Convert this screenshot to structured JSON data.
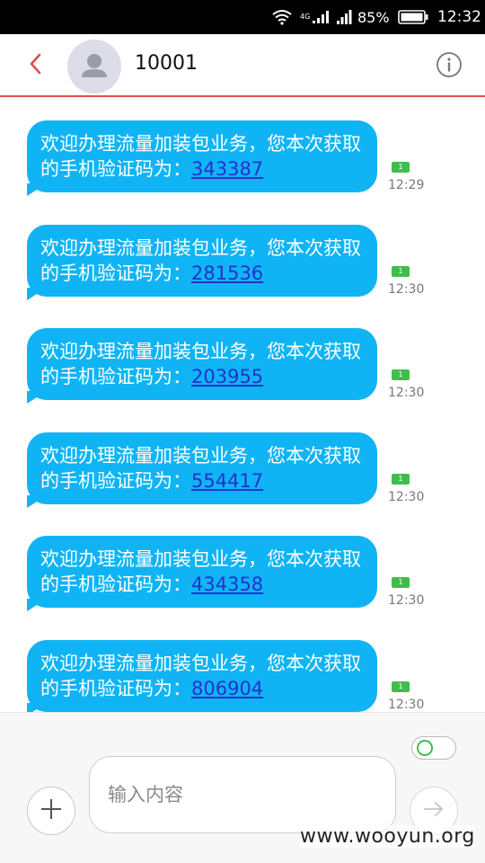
{
  "status_bar": {
    "network": "4G",
    "battery_percent": "85%",
    "clock": "12:32",
    "colors": {
      "background": "#000000",
      "text": "#ffffff"
    }
  },
  "header": {
    "contact_name": "10001",
    "back_icon": "chevron-left-icon",
    "info_icon": "info-icon",
    "accent_color": "#e0504a"
  },
  "messages": [
    {
      "text": "欢迎办理流量加装包业务，您本次获取的手机验证码为：",
      "code": "343387",
      "sim": "1",
      "time": "12:29"
    },
    {
      "text": "欢迎办理流量加装包业务，您本次获取的手机验证码为：",
      "code": "281536",
      "sim": "1",
      "time": "12:30"
    },
    {
      "text": "欢迎办理流量加装包业务，您本次获取的手机验证码为：",
      "code": "203955",
      "sim": "1",
      "time": "12:30"
    },
    {
      "text": "欢迎办理流量加装包业务，您本次获取的手机验证码为：",
      "code": "554417",
      "sim": "1",
      "time": "12:30"
    },
    {
      "text": "欢迎办理流量加装包业务，您本次获取的手机验证码为：",
      "code": "434358",
      "sim": "1",
      "time": "12:30"
    },
    {
      "text": "欢迎办理流量加装包业务，您本次获取的手机验证码为：",
      "code": "806904",
      "sim": "1",
      "time": "12:30"
    }
  ],
  "bubble_color": "#10b4f5",
  "compose": {
    "placeholder": "输入内容",
    "value": "",
    "add_icon": "plus-icon",
    "send_icon": "arrow-right-icon",
    "toggle_on": false
  },
  "watermark": "www.wooyun.org"
}
